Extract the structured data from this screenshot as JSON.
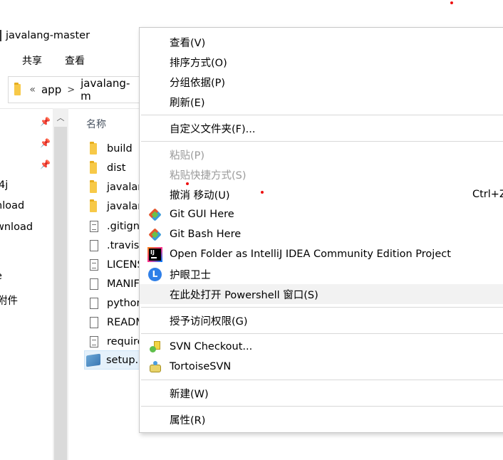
{
  "window": {
    "title": "javalang-master"
  },
  "ribbon": {
    "tabs": [
      "共享",
      "查看"
    ]
  },
  "address": {
    "overflow": "«",
    "crumbs": [
      "app",
      "javalang-m"
    ],
    "separator": ">"
  },
  "nav_pane": {
    "items": [
      "4j",
      "nload",
      "wnload",
      "e",
      "附件"
    ]
  },
  "file_list": {
    "column_name": "名称",
    "files": [
      {
        "name": "build",
        "icon": "folder-icon"
      },
      {
        "name": "dist",
        "icon": "folder-icon"
      },
      {
        "name": "javalan",
        "icon": "folder-icon"
      },
      {
        "name": "javalan",
        "icon": "folder-icon"
      },
      {
        "name": ".gitign",
        "icon": "file-icon"
      },
      {
        "name": ".travis.",
        "icon": "file-icon"
      },
      {
        "name": "LICENS",
        "icon": "file-icon"
      },
      {
        "name": "MANIF",
        "icon": "file-icon"
      },
      {
        "name": "pythor",
        "icon": "file-icon"
      },
      {
        "name": "READM",
        "icon": "file-icon"
      },
      {
        "name": "require",
        "icon": "file-icon"
      },
      {
        "name": "setup.",
        "icon": "python-file-icon"
      }
    ]
  },
  "context_menu": {
    "items": [
      {
        "label": "查看(V)"
      },
      {
        "label": "排序方式(O)"
      },
      {
        "label": "分组依据(P)"
      },
      {
        "label": "刷新(E)"
      },
      {
        "label": "自定义文件夹(F)..."
      },
      {
        "label": "粘贴(P)",
        "disabled": true
      },
      {
        "label": "粘贴快捷方式(S)",
        "disabled": true
      },
      {
        "label": "撤消 移动(U)",
        "shortcut": "Ctrl+Z"
      },
      {
        "label": "Git GUI Here",
        "icon": "git-gui-icon"
      },
      {
        "label": "Git Bash Here",
        "icon": "git-bash-icon"
      },
      {
        "label": "Open Folder as IntelliJ IDEA Community Edition Project",
        "icon": "intellij-icon"
      },
      {
        "label": "护眼卫士",
        "icon": "eye-guard-icon"
      },
      {
        "label": "在此处打开 Powershell 窗口(S)"
      },
      {
        "label": "授予访问权限(G)"
      },
      {
        "label": "SVN Checkout...",
        "icon": "svn-checkout-icon"
      },
      {
        "label": "TortoiseSVN",
        "icon": "tortoisesvn-icon"
      },
      {
        "label": "新建(W)"
      },
      {
        "label": "属性(R)"
      }
    ]
  },
  "colors": {
    "accent": "#2f7fe8",
    "disabled_text": "#9a9a9a",
    "hover_bg": "#f2f2f2",
    "selected_bg": "#e5f1fb"
  }
}
